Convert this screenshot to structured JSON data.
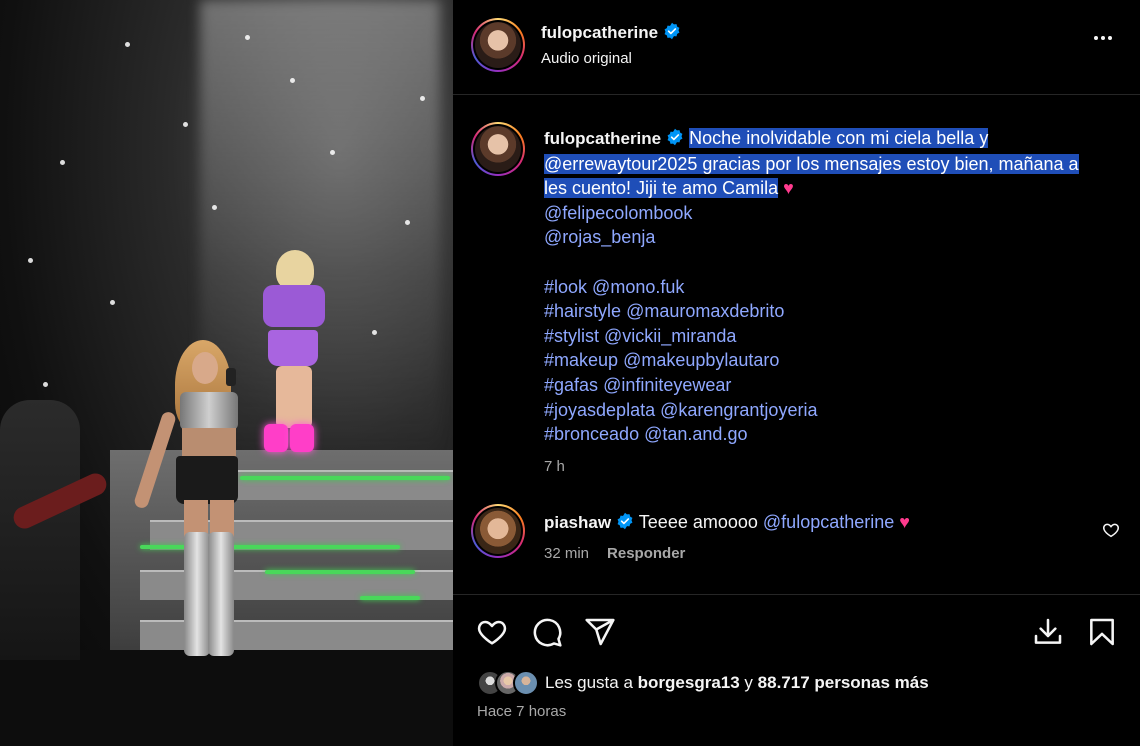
{
  "post": {
    "author": "fulopcatherine",
    "audio": "Audio original",
    "more_icon": "more-horizontal-icon"
  },
  "caption": {
    "author": "fulopcatherine",
    "highlighted_line1": "Noche inolvidable con mi ciela bella y",
    "highlighted_line2": "@errewaytour2025 gracias por los mensajes estoy bien, mañana a",
    "highlighted_line3": "les cuento! Jiji te amo Camila",
    "heart": "♥",
    "mentions": [
      "@felipecolombook",
      "@rojas_benja"
    ],
    "credits": [
      {
        "tag": "#look",
        "handle": "@mono.fuk"
      },
      {
        "tag": "#hairstyle",
        "handle": "@mauromaxdebrito"
      },
      {
        "tag": "#stylist",
        "handle": "@vickii_miranda"
      },
      {
        "tag": "#makeup",
        "handle": "@makeupbylautaro"
      },
      {
        "tag": "#gafas",
        "handle": "@infiniteyewear"
      },
      {
        "tag": "#joyasdeplata",
        "handle": "@karengrantjoyeria"
      },
      {
        "tag": "#bronceado",
        "handle": "@tan.and.go"
      }
    ],
    "time": "7 h"
  },
  "comment": {
    "author": "piashaw",
    "text": "Teeee amoooo",
    "mention": "@fulopcatherine",
    "heart": "♥",
    "time": "32 min",
    "reply": "Responder"
  },
  "likes": {
    "prefix": "Les gusta a",
    "user": "borgesgra13",
    "connector": "y",
    "count": "88.717 personas más"
  },
  "posted_ago": "Hace 7 horas",
  "colors": {
    "link": "#8fa8ff",
    "highlight": "#1f4eb8",
    "verified": "#0095f6",
    "heart": "#ff3b8e"
  }
}
